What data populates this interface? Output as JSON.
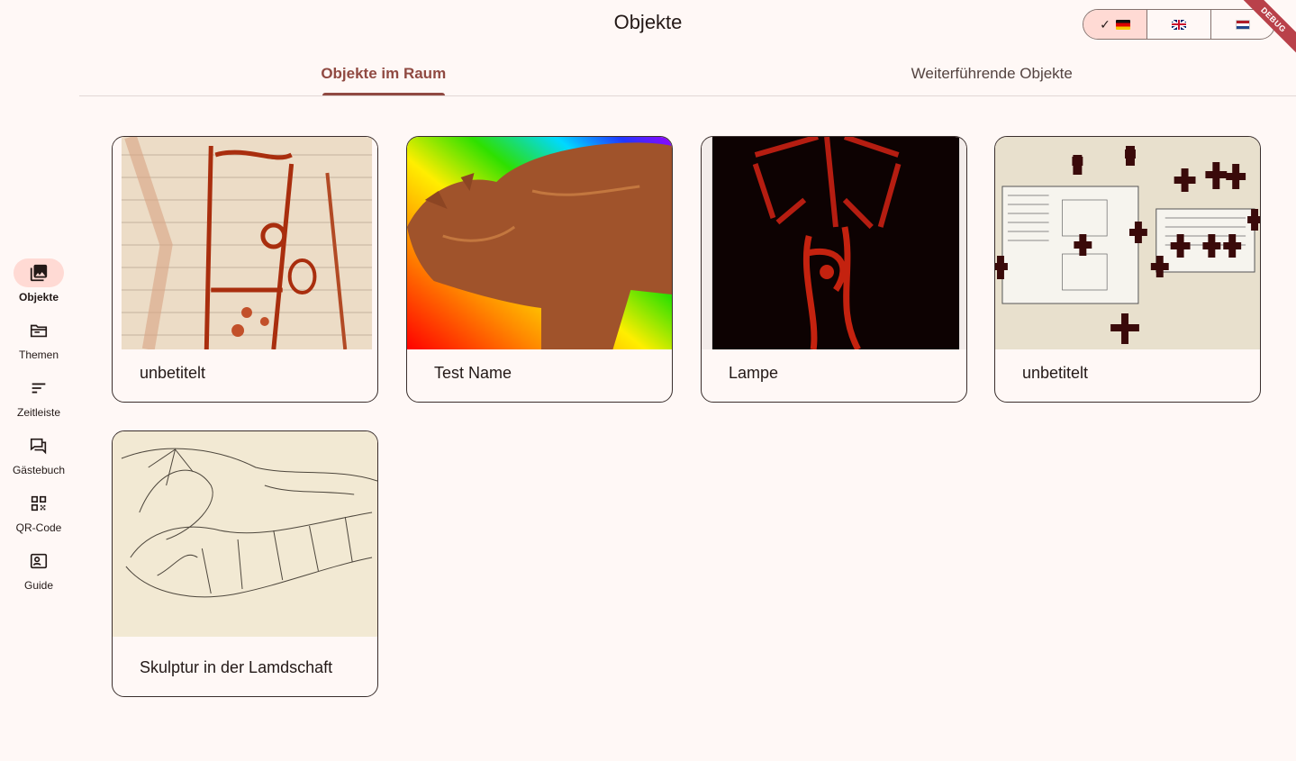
{
  "app": {
    "title": "Objekte",
    "debug_label": "DEBUG"
  },
  "languages": [
    {
      "code": "de",
      "selected": true
    },
    {
      "code": "gb",
      "selected": false
    },
    {
      "code": "nl",
      "selected": false
    }
  ],
  "tabs": [
    {
      "label": "Objekte im Raum",
      "active": true
    },
    {
      "label": "Weiterführende Objekte",
      "active": false
    }
  ],
  "rail": [
    {
      "label": "Objekte",
      "icon": "photo-library-icon",
      "active": true
    },
    {
      "label": "Themen",
      "icon": "folder-icon",
      "active": false
    },
    {
      "label": "Zeitleiste",
      "icon": "sort-icon",
      "active": false
    },
    {
      "label": "Gästebuch",
      "icon": "forum-icon",
      "active": false
    },
    {
      "label": "QR-Code",
      "icon": "qr-code-icon",
      "active": false
    },
    {
      "label": "Guide",
      "icon": "guide-icon",
      "active": false
    }
  ],
  "objects": [
    {
      "title": "unbetitelt"
    },
    {
      "title": "Test Name"
    },
    {
      "title": "Lampe"
    },
    {
      "title": "unbetitelt"
    },
    {
      "title": "Skulptur in der Lamdschaft"
    }
  ],
  "colors": {
    "primary": "#904a42",
    "selected_bg": "#ffdad4",
    "background": "#fff8f6"
  }
}
